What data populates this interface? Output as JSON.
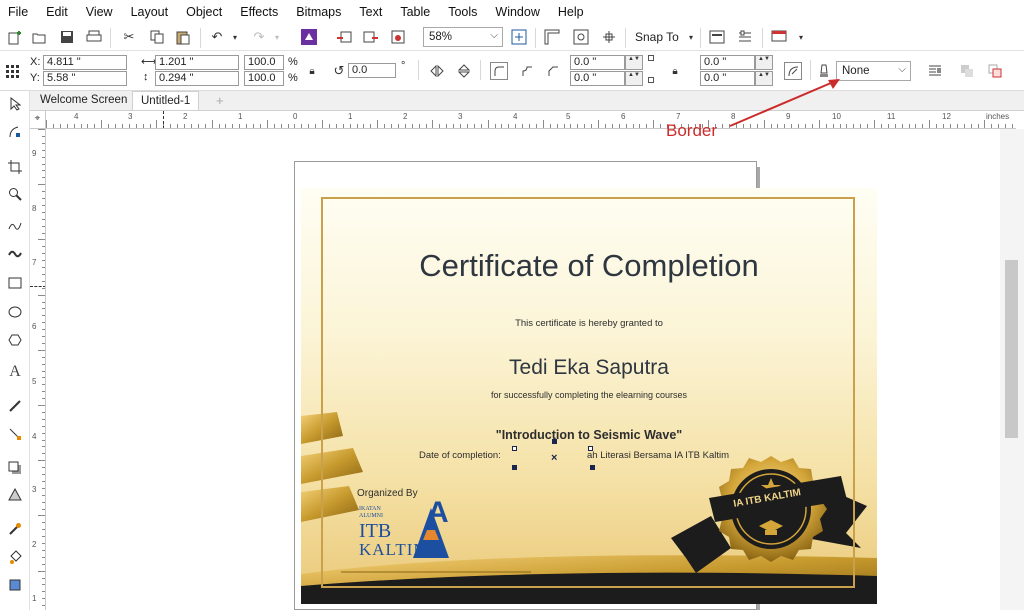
{
  "menu": [
    "File",
    "Edit",
    "View",
    "Layout",
    "Object",
    "Effects",
    "Bitmaps",
    "Text",
    "Table",
    "Tools",
    "Window",
    "Help"
  ],
  "toolbar": {
    "zoom_value": "58%",
    "snap_to_label": "Snap To"
  },
  "property_bar": {
    "x_label": "X:",
    "x_value": "4.811 \"",
    "y_label": "Y:",
    "y_value": "5.58 \"",
    "width_value": "1.201 \"",
    "height_value": "0.294 \"",
    "scale_w": "100.0",
    "scale_h": "100.0",
    "percent_sign": "%",
    "rotation_value": "0.0",
    "degree_sign": "°",
    "corner_tl": "0.0 \"",
    "corner_bl": "0.0 \"",
    "corner_tr": "0.0 \"",
    "corner_br": "0.0 \"",
    "outline_value": "None"
  },
  "tabs": {
    "welcome": "Welcome Screen",
    "document": "Untitled-1",
    "add": "+"
  },
  "ruler": {
    "corner_icon": "⌖",
    "h_numbers": [
      "4",
      "3",
      "2",
      "1",
      "0",
      "1",
      "2",
      "3",
      "4",
      "5",
      "6",
      "7",
      "8",
      "9",
      "10",
      "11",
      "12"
    ],
    "unit": "inches",
    "v_numbers": [
      "9",
      "8",
      "7",
      "6",
      "5",
      "4",
      "3",
      "2",
      "1"
    ]
  },
  "certificate": {
    "title": "Certificate of Completion",
    "granted_line": "This certificate is hereby granted to",
    "recipient": "Tedi Eka Saputra",
    "completion_line": "for successfully completing the elearning courses",
    "course_title": "\"Introduction to Seismic Wave\"",
    "date_label": "Date of completion:",
    "host_line": "ah Literasi Bersama IA ITB Kaltim",
    "organized_by": "Organized By",
    "logo_small_1": "IKATAN",
    "logo_small_2": "ALUMNI",
    "logo_itb": "ITB",
    "logo_kaltim": "KALTIM",
    "logo_letter": "A",
    "seal_text": "IA ITB KALTIM"
  },
  "annotation": {
    "label": "Border",
    "color": "#cc2b2b"
  },
  "colors": {
    "gold": "#c8a14a",
    "dark_ribbon": "#1c1c1c",
    "accent_purple": "#6b2fa0",
    "selection_handle": "#1a2550"
  }
}
